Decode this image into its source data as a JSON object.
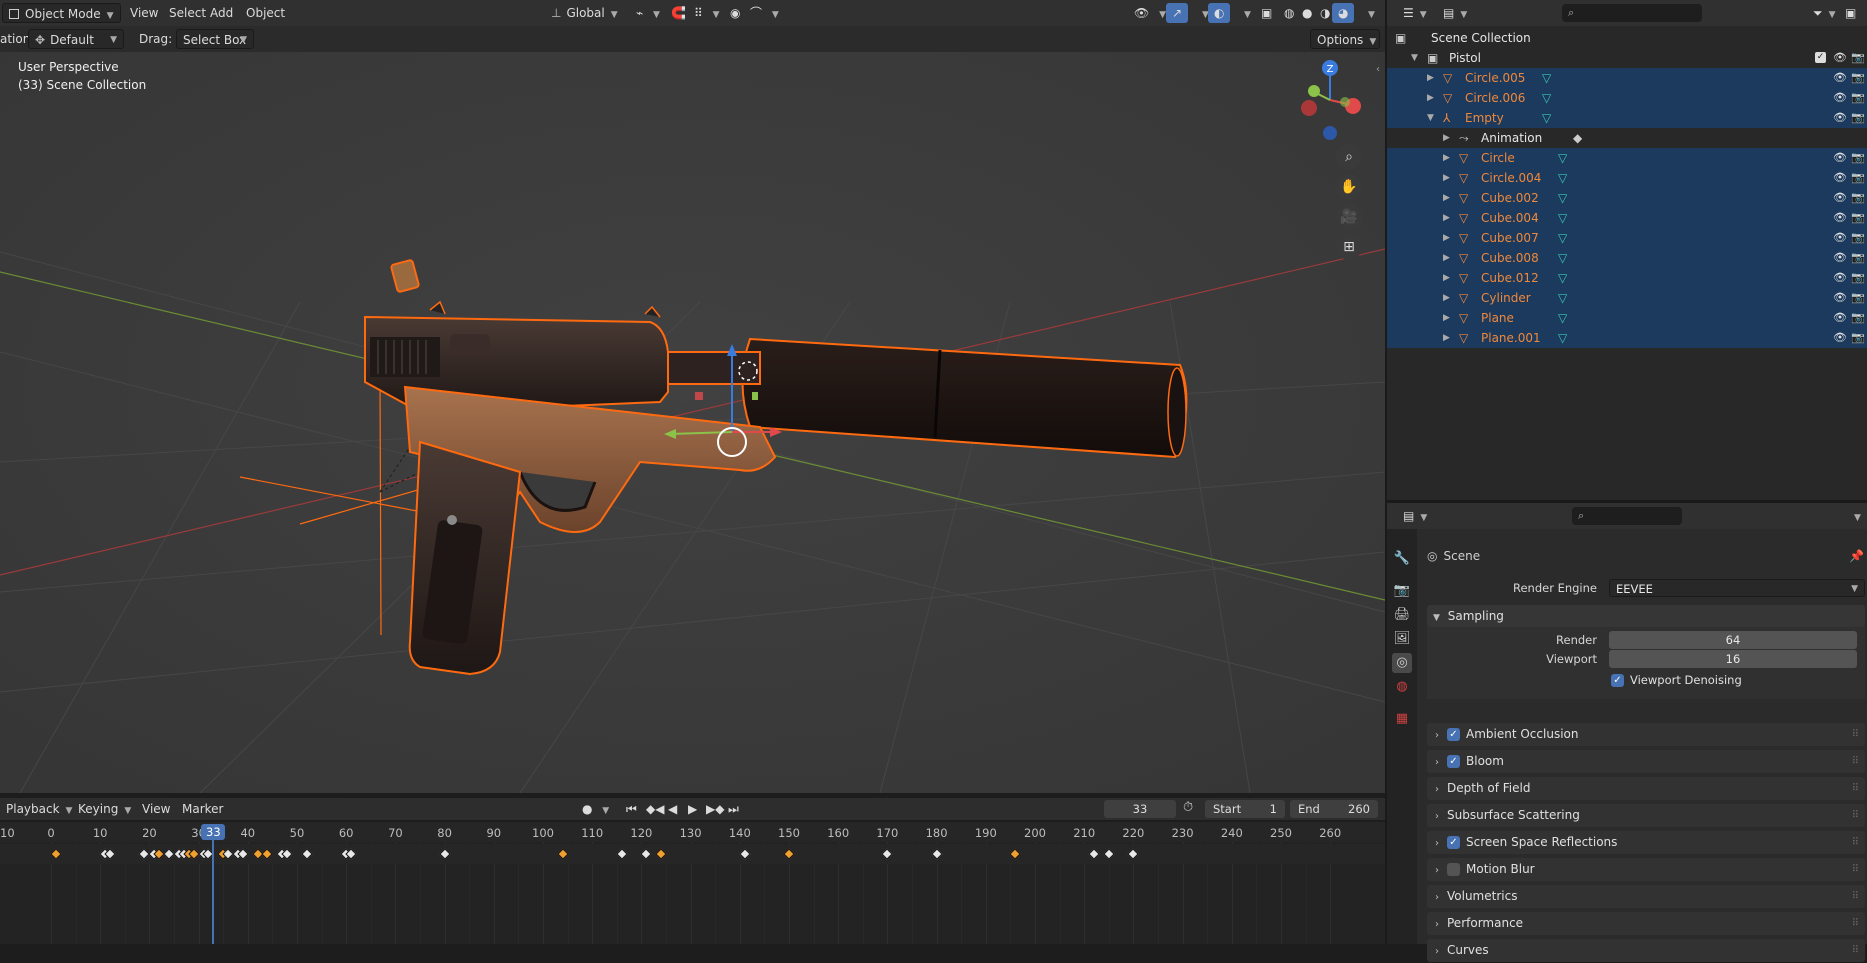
{
  "viewport_header": {
    "mode": "Object Mode",
    "menus": [
      "View",
      "Select",
      "Add",
      "Object"
    ],
    "orientation": "Global"
  },
  "tool_header": {
    "orientation_label": "ation:",
    "orientation_value": "Default",
    "drag_label": "Drag:",
    "drag_value": "Select Box",
    "options": "Options"
  },
  "viewport": {
    "perspective": "User Perspective",
    "collection": "(33) Scene Collection",
    "gizmo_axis": "Z"
  },
  "outliner": {
    "root": "Scene Collection",
    "collection": "Pistol",
    "items": [
      {
        "name": "Circle.005",
        "selected": true,
        "depth": 1
      },
      {
        "name": "Circle.006",
        "selected": true,
        "depth": 1
      },
      {
        "name": "Empty",
        "selected": true,
        "depth": 1
      },
      {
        "name": "Animation",
        "selected": false,
        "depth": 2
      },
      {
        "name": "Circle",
        "selected": true,
        "depth": 2
      },
      {
        "name": "Circle.004",
        "selected": true,
        "depth": 2
      },
      {
        "name": "Cube.002",
        "selected": true,
        "depth": 2
      },
      {
        "name": "Cube.004",
        "selected": true,
        "depth": 2
      },
      {
        "name": "Cube.007",
        "selected": true,
        "depth": 2
      },
      {
        "name": "Cube.008",
        "selected": true,
        "depth": 2
      },
      {
        "name": "Cube.012",
        "selected": true,
        "depth": 2
      },
      {
        "name": "Cylinder",
        "selected": true,
        "depth": 2
      },
      {
        "name": "Plane",
        "selected": true,
        "depth": 2
      },
      {
        "name": "Plane.001",
        "selected": true,
        "depth": 2
      }
    ]
  },
  "properties": {
    "context": "Scene",
    "render_engine_label": "Render Engine",
    "render_engine": "EEVEE",
    "sampling": {
      "title": "Sampling",
      "render_label": "Render",
      "render": "64",
      "viewport_label": "Viewport",
      "viewport": "16",
      "denoise_label": "Viewport Denoising",
      "denoise": true
    },
    "panels": [
      {
        "label": "Ambient Occlusion",
        "checkbox": true,
        "checked": true
      },
      {
        "label": "Bloom",
        "checkbox": true,
        "checked": true
      },
      {
        "label": "Depth of Field",
        "checkbox": false,
        "checked": false
      },
      {
        "label": "Subsurface Scattering",
        "checkbox": false,
        "checked": false
      },
      {
        "label": "Screen Space Reflections",
        "checkbox": true,
        "checked": true
      },
      {
        "label": "Motion Blur",
        "checkbox": true,
        "checked": false
      },
      {
        "label": "Volumetrics",
        "checkbox": false,
        "checked": false
      },
      {
        "label": "Performance",
        "checkbox": false,
        "checked": false
      },
      {
        "label": "Curves",
        "checkbox": false,
        "checked": false
      }
    ]
  },
  "timeline": {
    "menus": [
      "Playback",
      "Keying",
      "View",
      "Marker"
    ],
    "current_frame": "33",
    "start_label": "Start",
    "start": "1",
    "end_label": "End",
    "end": "260",
    "ruler": [
      "10",
      "0",
      "10",
      "20",
      "30",
      "40",
      "50",
      "60",
      "70",
      "80",
      "90",
      "100",
      "110",
      "120",
      "130",
      "140",
      "150",
      "160",
      "170",
      "180",
      "190",
      "200",
      "210",
      "220",
      "230",
      "240",
      "250",
      "260"
    ],
    "keyframes": [
      1,
      11,
      12,
      19,
      21,
      22,
      24,
      26,
      27,
      28,
      29,
      31,
      32,
      35,
      36,
      38,
      39,
      42,
      44,
      47,
      48,
      52,
      60,
      61,
      80,
      104,
      116,
      121,
      124,
      141,
      150,
      170,
      180,
      196,
      212,
      215,
      220
    ],
    "selected_keyframes": [
      1,
      22,
      28,
      29,
      35,
      42,
      44,
      104,
      124,
      150,
      196
    ]
  },
  "colors": {
    "selection_outline": "#ff6a10",
    "outliner_selected": "#1b3a5e",
    "accent_blue": "#4772b3"
  }
}
